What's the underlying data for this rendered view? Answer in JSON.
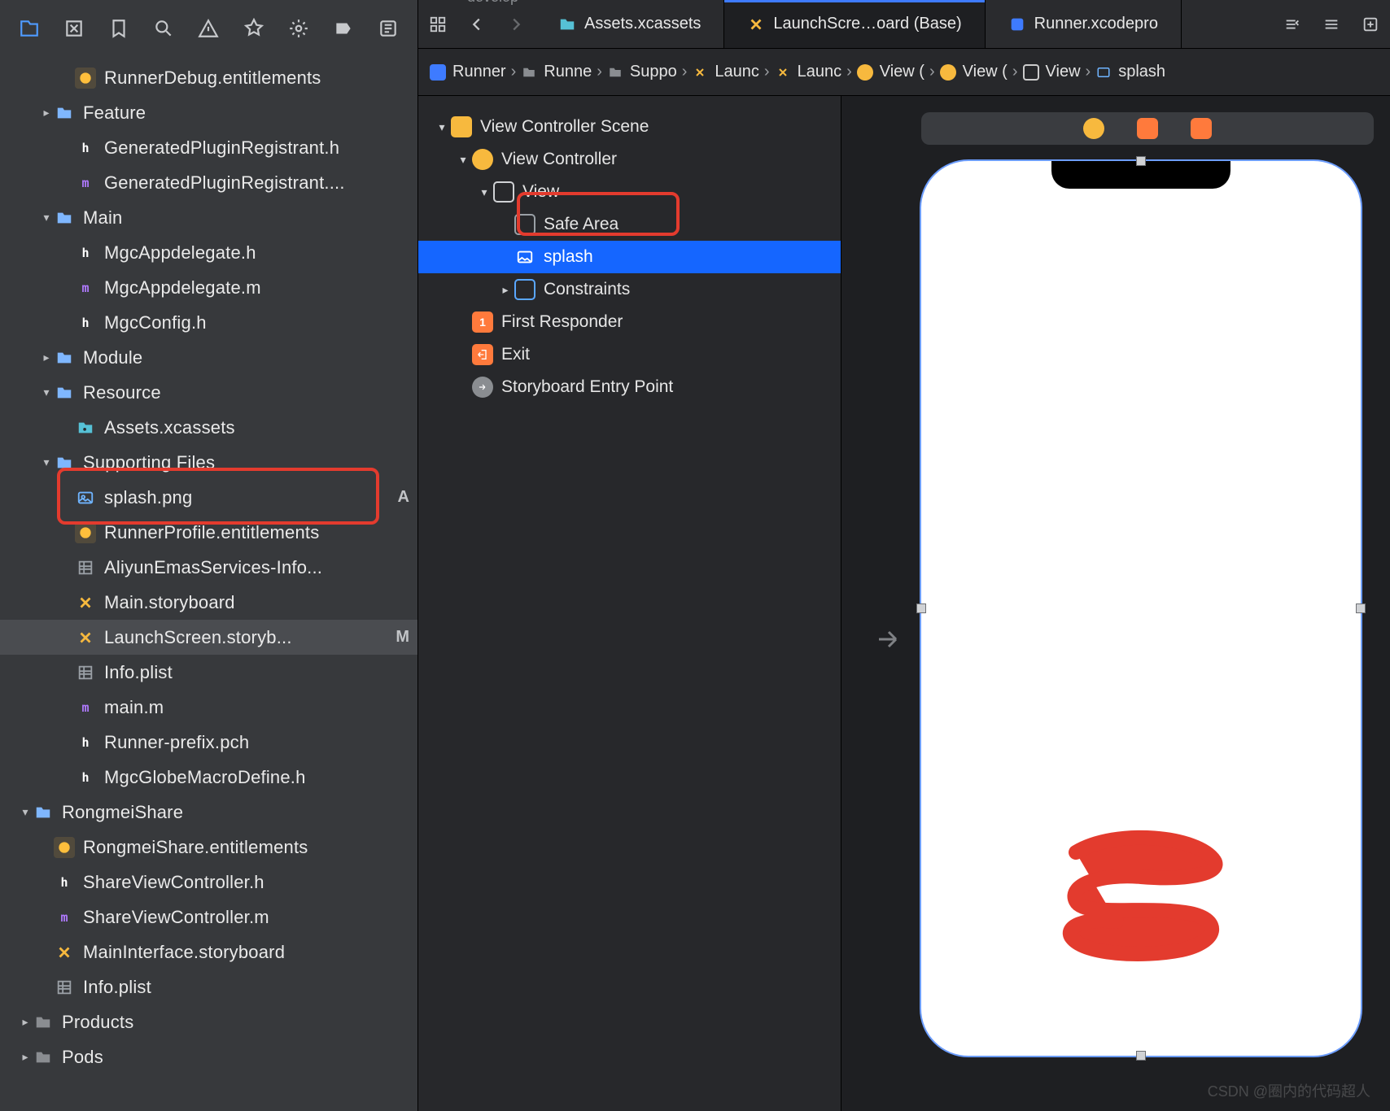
{
  "branch_label": "develop",
  "tabs": {
    "assets": "Assets.xcassets",
    "launch": "LaunchScre…oard (Base)",
    "runner": "Runner.xcodepro"
  },
  "path": {
    "p0": "Runner",
    "p1": "Runne",
    "p2": "Suppo",
    "p3": "Launc",
    "p4": "Launc",
    "p5": "View (",
    "p6": "View (",
    "p7": "View",
    "p8": "splash"
  },
  "outline": {
    "scene": "View Controller Scene",
    "vc": "View Controller",
    "view": "View",
    "safe": "Safe Area",
    "splash": "splash",
    "constraints": "Constraints",
    "first": "First Responder",
    "exit": "Exit",
    "entry": "Storyboard Entry Point"
  },
  "files": {
    "f0": "RunnerDebug.entitlements",
    "f1": "Feature",
    "f2": "GeneratedPluginRegistrant.h",
    "f3": "GeneratedPluginRegistrant....",
    "f4": "Main",
    "f5": "MgcAppdelegate.h",
    "f6": "MgcAppdelegate.m",
    "f7": "MgcConfig.h",
    "f8": "Module",
    "f9": "Resource",
    "f10": "Assets.xcassets",
    "f11": "Supporting Files",
    "f12": "splash.png",
    "f12b": "A",
    "f13": "RunnerProfile.entitlements",
    "f14": "AliyunEmasServices-Info...",
    "f15": "Main.storyboard",
    "f16": "LaunchScreen.storyb...",
    "f16b": "M",
    "f17": "Info.plist",
    "f18": "main.m",
    "f19": "Runner-prefix.pch",
    "f20": "MgcGlobeMacroDefine.h",
    "f21": "RongmeiShare",
    "f22": "RongmeiShare.entitlements",
    "f23": "ShareViewController.h",
    "f24": "ShareViewController.m",
    "f25": "MainInterface.storyboard",
    "f26": "Info.plist",
    "f27": "Products",
    "f28": "Pods"
  },
  "watermark": "CSDN @圈内的代码超人"
}
